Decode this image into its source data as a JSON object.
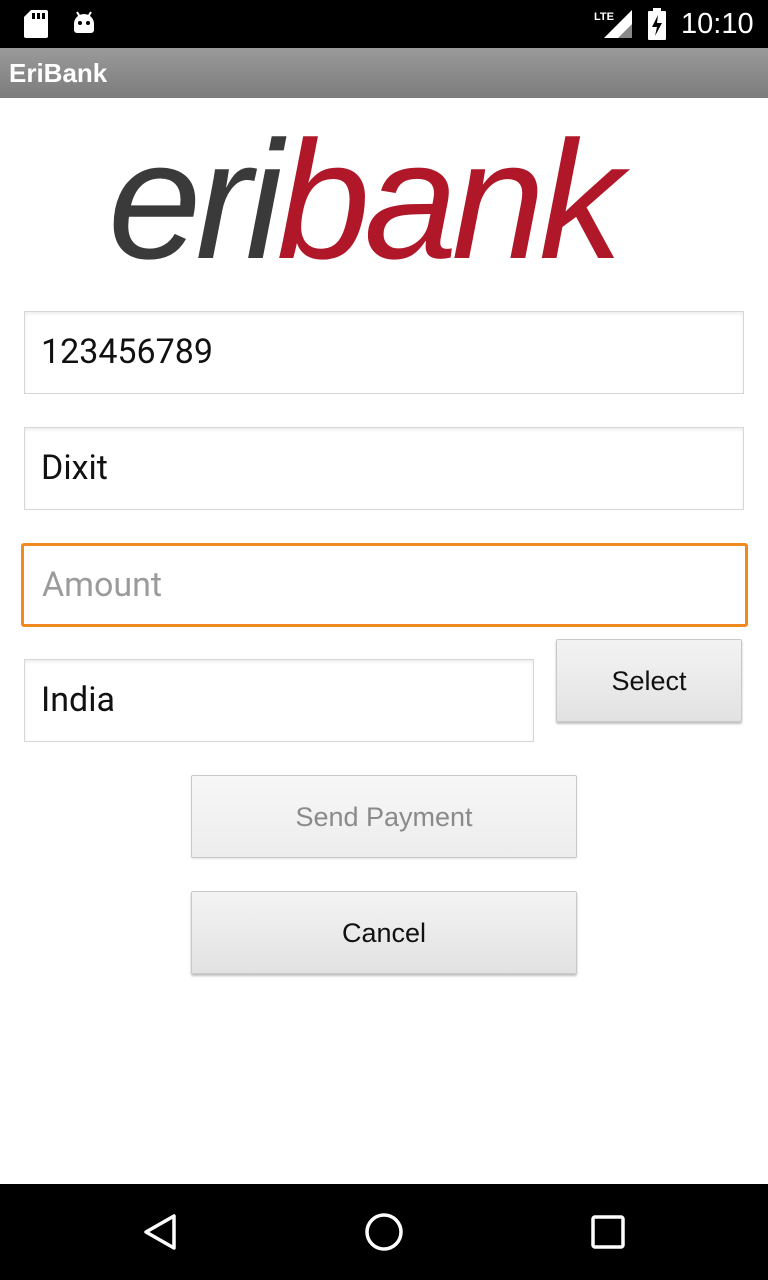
{
  "status_bar": {
    "time": "10:10",
    "network": "LTE",
    "icons": [
      "sd-card-icon",
      "android-debug-icon",
      "lte-signal-icon",
      "battery-charging-icon"
    ]
  },
  "app_bar": {
    "title": "EriBank"
  },
  "logo": {
    "part1": "eri",
    "part2": "bank",
    "color_dark": "#3a3a3a",
    "color_brand": "#b0182a"
  },
  "form": {
    "phone": {
      "value": "123456789"
    },
    "name": {
      "value": "Dixit"
    },
    "amount": {
      "value": "",
      "placeholder": "Amount"
    },
    "country": {
      "value": "India"
    },
    "select_label": "Select",
    "send_label": "Send Payment",
    "cancel_label": "Cancel"
  },
  "colors": {
    "focus_border": "#f0891e",
    "action_bar": "#8a8a8a"
  },
  "nav_bar": {
    "icons": [
      "back-icon",
      "home-icon",
      "recents-icon"
    ]
  }
}
